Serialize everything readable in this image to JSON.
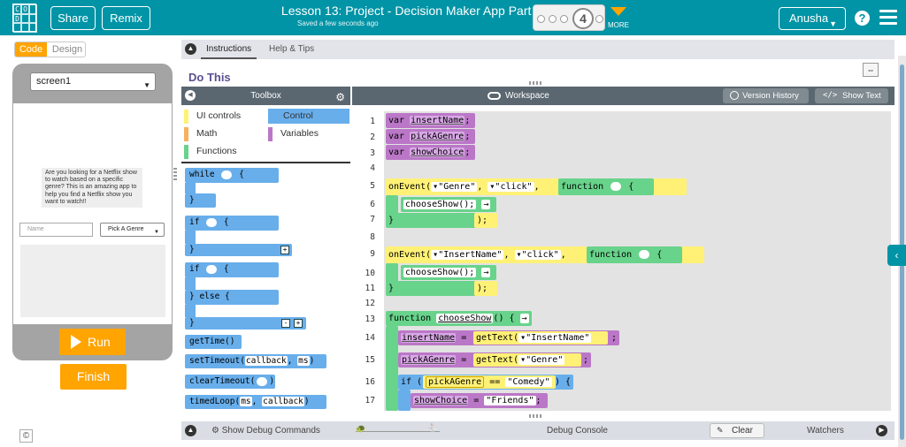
{
  "topbar": {
    "logo_letters": [
      "C",
      "O",
      "",
      "D",
      "",
      "",
      "",
      "",
      ""
    ],
    "share_label": "Share",
    "remix_label": "Remix",
    "lesson_title": "Lesson 13: Project - Decision Maker App Part 2",
    "saved_status": "Saved a few seconds ago",
    "progress_current": "4",
    "more_label": "MORE",
    "user_name": "Anusha",
    "help_label": "?"
  },
  "left_panel": {
    "code_tab": "Code",
    "design_tab": "Design",
    "screen_selected": "screen1",
    "app": {
      "prompt": "Are you looking for a Netflix show to watch based on a specific genre? This is an amazing app to help you find a Netflix show you want to watch!!",
      "name_placeholder": "Name",
      "genre_dropdown_value": "Pick A Genre"
    },
    "run_label": "Run",
    "finish_label": "Finish",
    "copyright": "©"
  },
  "instructions": {
    "tabs": [
      "Instructions",
      "Help & Tips"
    ],
    "heading": "Do This"
  },
  "toolbox": {
    "title": "Toolbox",
    "categories": [
      {
        "label": "UI controls",
        "color": "#fff176"
      },
      {
        "label": "Control",
        "color": "#68aeeb",
        "selected": true
      },
      {
        "label": "Math",
        "color": "#f7b15f"
      },
      {
        "label": "Variables",
        "color": "#bb77c7"
      },
      {
        "label": "Functions",
        "color": "#68d38b"
      }
    ],
    "blocks": {
      "while_kw": "while",
      "while_brace": "{",
      "if_kw": "if",
      "if_brace": "{",
      "ifelse_kw": "if",
      "ifelse_brace": "{",
      "else_kw": "} else {",
      "close_brace": "}",
      "plus": "+",
      "minus": "-",
      "get_time": "getTime()",
      "set_timeout": "setTimeout(",
      "set_timeout_arg1": "callback",
      "set_timeout_arg2": "ms",
      "clear_timeout": "clearTimeout(",
      "timed_loop": "timedLoop(",
      "timed_loop_arg1": "ms",
      "timed_loop_arg2": "callback",
      "comma": ",",
      "close_paren": ")"
    }
  },
  "workspace": {
    "title": "Workspace",
    "version_history": "Version History",
    "show_text": "Show Text",
    "show_text_icon": "</>",
    "line_numbers": [
      "1",
      "2",
      "3",
      "4",
      "5",
      "6",
      "7",
      "8",
      "9",
      "10",
      "11",
      "12",
      "13",
      "14",
      "15",
      "16",
      "17"
    ],
    "code": {
      "var_kw": "var",
      "v1": "insertName",
      "v2": "pickAGenre",
      "v3": "showChoice",
      "semicolon": ";",
      "on_event": "onEvent(",
      "genre_lit": "▾\"Genre\"",
      "click_lit": "▾\"click\"",
      "insert_lit": "▾\"InsertName\"",
      "function_kw": "function",
      "brace_open": "{",
      "close_callback": "}",
      "close_paren_semi": ");",
      "choose_show_call": "chooseShow();",
      "function_decl": "function",
      "fn_name": "chooseShow",
      "fn_sig_rest": "() {",
      "equals": "=",
      "get_text": "getText(",
      "get_text_insert": "▾\"InsertName\"",
      "get_text_genre": "▾\"Genre\"",
      "close_get_text": ");",
      "if_kw": "if (",
      "cmp_var": "pickAGenre",
      "cmp_op": "==",
      "cmp_val": "\"Comedy\"",
      "if_close": ") {",
      "assign_var": "showChoice",
      "assign_val": "\"Friends\"",
      "comma": ","
    }
  },
  "debug": {
    "show_debug": "Show Debug Commands",
    "console": "Debug Console",
    "clear": "Clear",
    "watchers": "Watchers"
  }
}
